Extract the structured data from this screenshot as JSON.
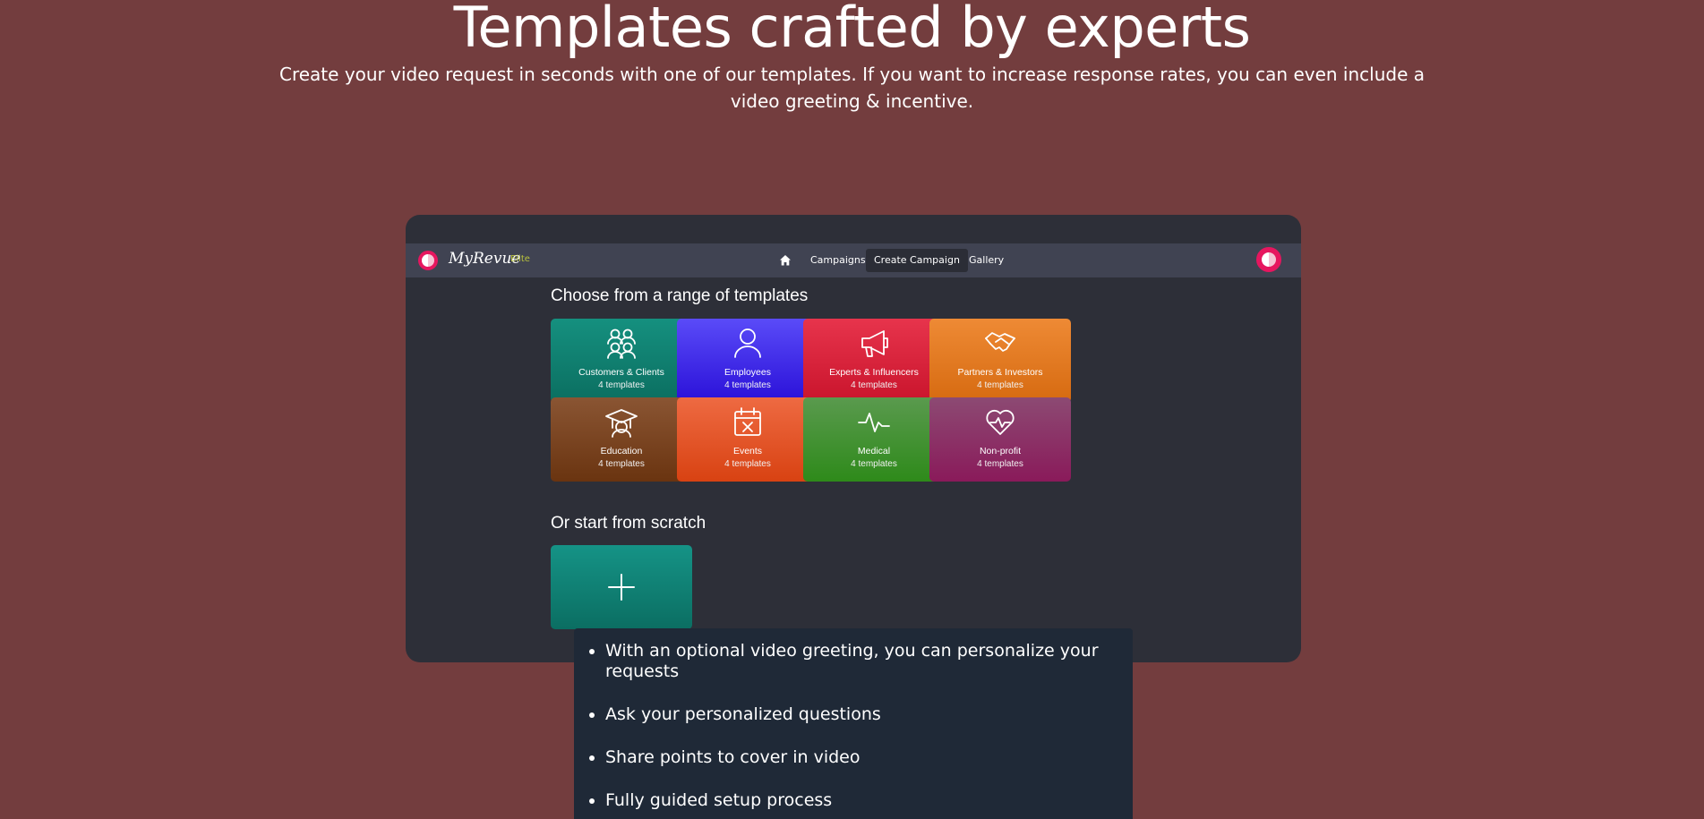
{
  "hero": {
    "title": "Templates crafted by experts",
    "subtitle": "Create your video request in seconds with one of our templates. If you want to increase response rates, you can even include a video greeting & incentive."
  },
  "app": {
    "brand": "MyRevue",
    "brand_tag": "Elite",
    "nav": {
      "home_icon": "home-icon",
      "items": [
        "Campaigns",
        "Create Campaign",
        "Gallery"
      ],
      "active": "Create Campaign"
    },
    "templates_heading": "Choose from a range of templates",
    "templates": [
      {
        "name": "Customers & Clients",
        "count": "4 templates",
        "icon": "people-group-icon",
        "colors": [
          "#15907f",
          "#0b6e60"
        ]
      },
      {
        "name": "Employees",
        "count": "4 templates",
        "icon": "person-icon",
        "colors": [
          "#5a4bf8",
          "#2a10d8"
        ]
      },
      {
        "name": "Experts & Influencers",
        "count": "4 templates",
        "icon": "megaphone-icon",
        "colors": [
          "#e7344c",
          "#c9142c"
        ]
      },
      {
        "name": "Partners & Investors",
        "count": "4 templates",
        "icon": "handshake-icon",
        "colors": [
          "#ee8a35",
          "#d66a10"
        ]
      },
      {
        "name": "Education",
        "count": "4 templates",
        "icon": "graduation-cap-icon",
        "colors": [
          "#8a5533",
          "#6a3410"
        ]
      },
      {
        "name": "Events",
        "count": "4 templates",
        "icon": "calendar-x-icon",
        "colors": [
          "#ee6a42",
          "#d84212"
        ]
      },
      {
        "name": "Medical",
        "count": "4 templates",
        "icon": "pulse-icon",
        "colors": [
          "#5a9a4e",
          "#2e8a1a"
        ]
      },
      {
        "name": "Non-profit",
        "count": "4 templates",
        "icon": "heart-pulse-icon",
        "colors": [
          "#8c4a73",
          "#8a1a5a"
        ]
      }
    ],
    "scratch_heading": "Or start from scratch",
    "scratch_icon": "plus-icon"
  },
  "features": [
    "With an optional video greeting, you can personalize your requests",
    "Ask your personalized questions",
    "Share points to cover in video",
    "Fully guided setup process"
  ]
}
